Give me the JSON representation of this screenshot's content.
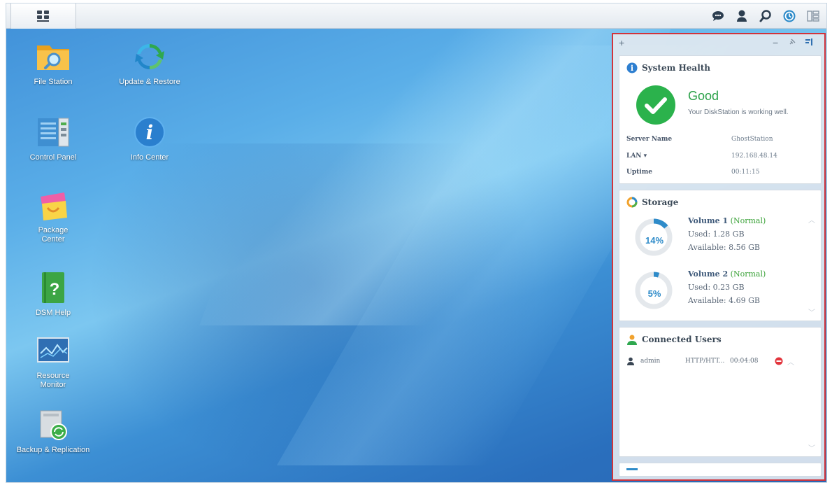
{
  "taskbar": {
    "main_menu_icon": "grid-menu-icon",
    "tray_icons": [
      "chat-icon",
      "user-icon",
      "search-icon",
      "notification-icon",
      "widgets-toggle-icon"
    ]
  },
  "desktop": {
    "icons": [
      {
        "label": "File Station",
        "icon": "folder-magnifier-icon"
      },
      {
        "label": "Update & Restore",
        "icon": "update-restore-icon"
      },
      {
        "label": "Control Panel",
        "icon": "control-panel-icon"
      },
      {
        "label": "Info Center",
        "icon": "info-icon"
      },
      {
        "label": "Package\nCenter",
        "icon": "package-bag-icon"
      },
      {
        "label": "DSM Help",
        "icon": "help-book-icon"
      },
      {
        "label": "Resource\nMonitor",
        "icon": "resource-monitor-icon"
      },
      {
        "label": "Backup & Replication",
        "icon": "backup-icon"
      }
    ]
  },
  "widgets": {
    "toolbar": {
      "add": "+",
      "minimize": "−",
      "pin": "pin-icon",
      "settings": "widget-settings-icon"
    },
    "system_health": {
      "title": "System Health",
      "status": "Good",
      "message": "Your DiskStation is working well.",
      "rows": [
        {
          "key": "Server Name",
          "value": "GhostStation"
        },
        {
          "key": "LAN ▾",
          "value": "192.168.48.14"
        },
        {
          "key": "Uptime",
          "value": "00:11:15"
        }
      ]
    },
    "storage": {
      "title": "Storage",
      "volumes": [
        {
          "name": "Volume 1",
          "status": "(Normal)",
          "percent_label": "14%",
          "percent": 14,
          "used": "Used: 1.28 GB",
          "available": "Available: 8.56 GB"
        },
        {
          "name": "Volume 2",
          "status": "(Normal)",
          "percent_label": "5%",
          "percent": 5,
          "used": "Used: 0.23 GB",
          "available": "Available: 4.69 GB"
        }
      ]
    },
    "connected_users": {
      "title": "Connected Users",
      "users": [
        {
          "name": "admin",
          "type": "HTTP/HTT...",
          "time": "00:04:08"
        }
      ]
    }
  },
  "colors": {
    "accent": "#2e8bc9",
    "good": "#2bb24c",
    "normal": "#3aa238",
    "highlight_border": "#d1343c"
  }
}
